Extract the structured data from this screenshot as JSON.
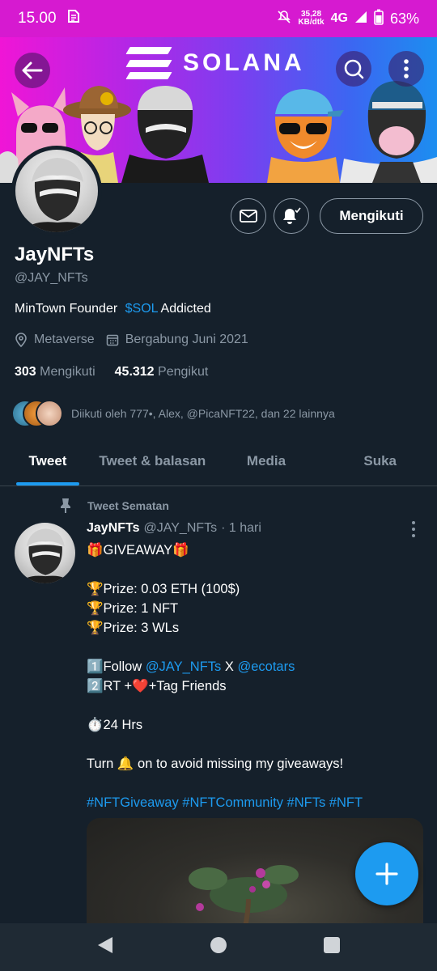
{
  "status_bar": {
    "time": "15.00",
    "net_speed_top": "35,28",
    "net_speed_bottom": "KB/dtk",
    "network": "4G",
    "battery": "63%"
  },
  "banner": {
    "logo_text": "SOLANA"
  },
  "profile": {
    "name": "JayNFTs",
    "handle": "@JAY_NFTs",
    "bio_prefix": "MinTown Founder ",
    "bio_link": "$SOL",
    "bio_suffix": " Addicted",
    "location": "Metaverse",
    "joined": "Bergabung Juni 2021",
    "following_count": "303",
    "following_label": "Mengikuti",
    "followers_count": "45.312",
    "followers_label": "Pengikut",
    "followed_by": "Diikuti oleh 777•, Alex, @PicaNFT22, dan 22 lainnya",
    "follow_button": "Mengikuti"
  },
  "tabs": [
    "Tweet",
    "Tweet & balasan",
    "Media",
    "Suka"
  ],
  "tweet": {
    "pinned_label": "Tweet Sematan",
    "author": "JayNFTs",
    "handle": "@JAY_NFTs",
    "time": "· 1 hari",
    "line1": "🎁GIVEAWAY🎁",
    "line2": "🏆Prize: 0.03 ETH (100$)",
    "line3": "🏆Prize: 1 NFT",
    "line4": "🏆Prize: 3 WLs",
    "line5_prefix": "1️⃣Follow ",
    "line5_link1": "@JAY_NFTs",
    "line5_mid": " X ",
    "line5_link2": "@ecotars",
    "line6": "2️⃣RT +❤️+Tag Friends",
    "line7": "⏱️24 Hrs",
    "line8": "Turn 🔔 on to avoid missing my giveaways!",
    "hashtags": "#NFTGiveaway #NFTCommunity #NFTs #NFT"
  },
  "colors": {
    "accent": "#1d9bf0",
    "background": "#15202b",
    "status_bar": "#d61ad0"
  }
}
